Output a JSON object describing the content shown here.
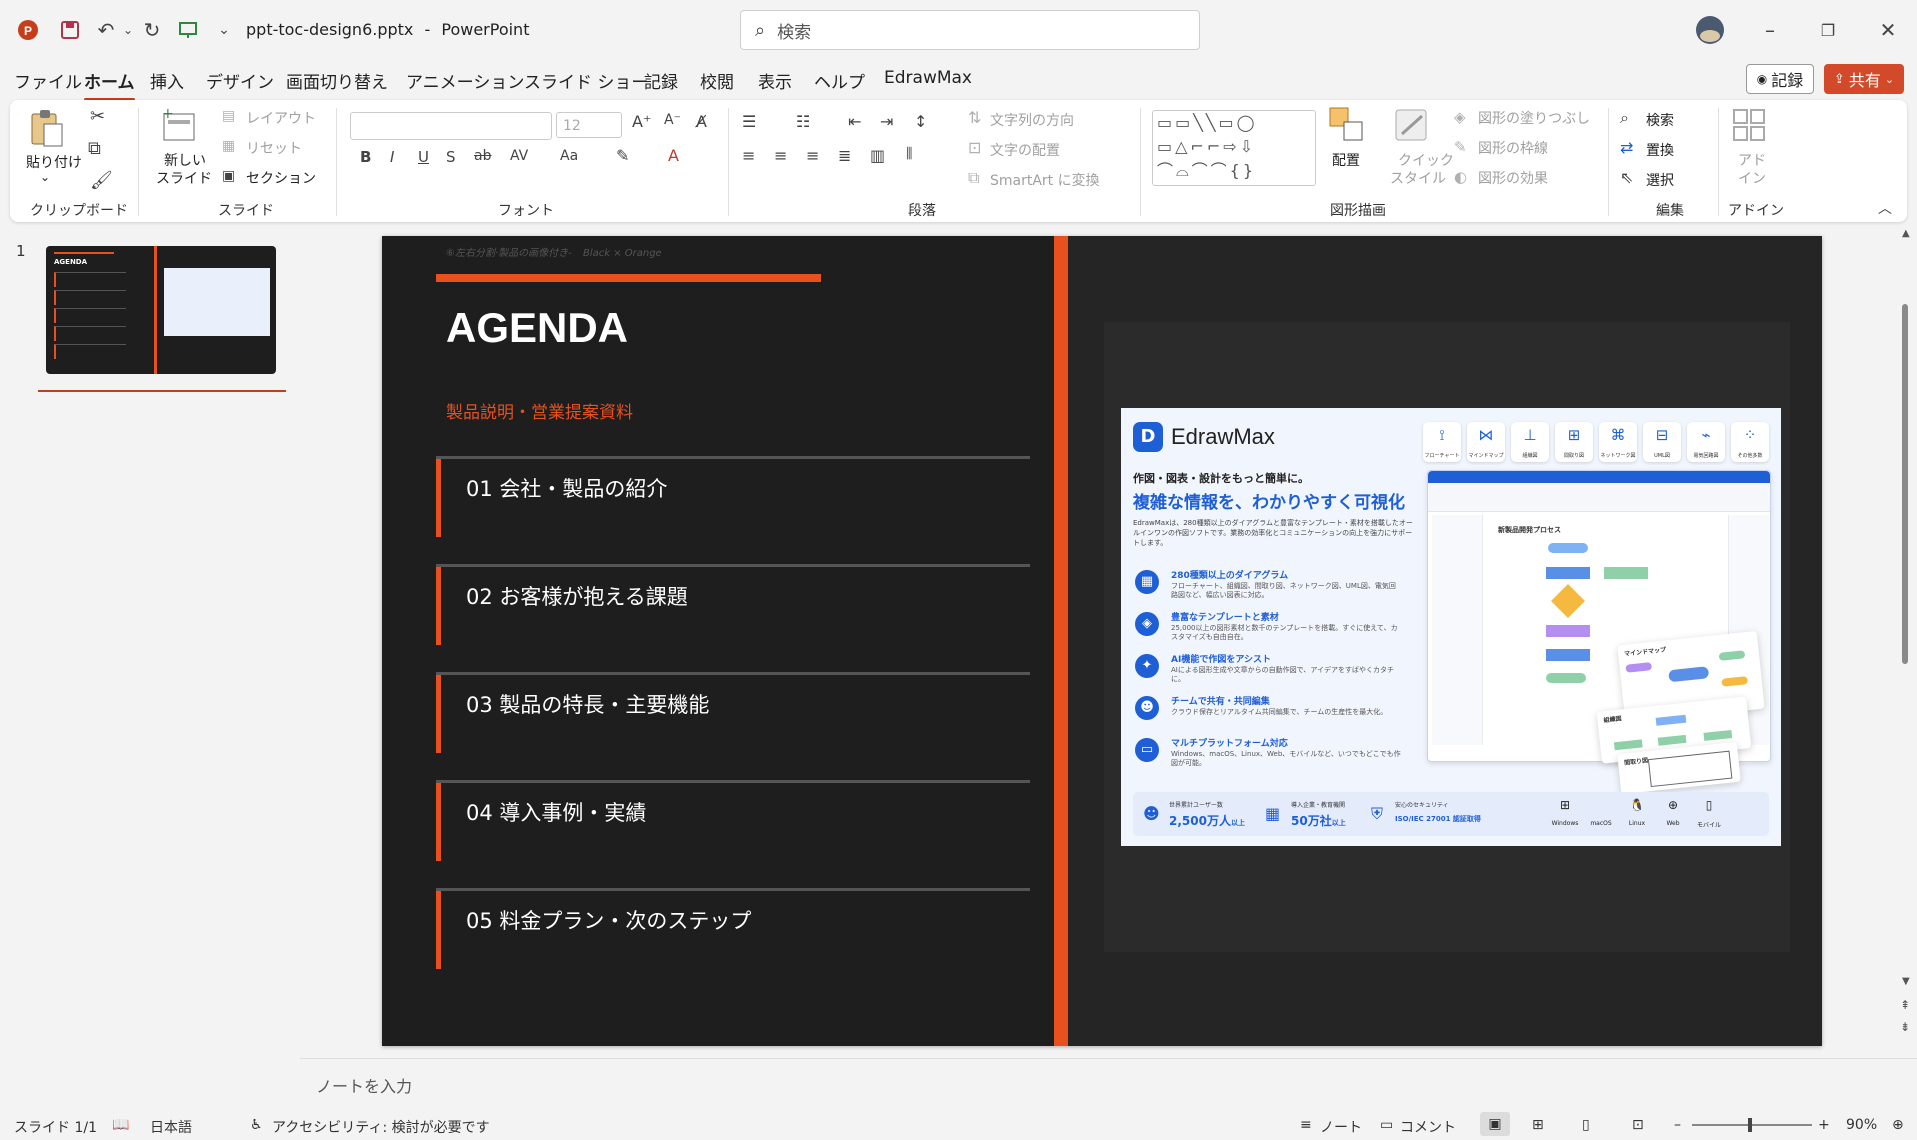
{
  "titlebar": {
    "filename": "ppt-toc-design6.pptx",
    "separator": "-",
    "app_name": "PowerPoint",
    "search_placeholder": "検索"
  },
  "menu": {
    "tabs": [
      "ファイル",
      "ホーム",
      "挿入",
      "デザイン",
      "画面切り替え",
      "アニメーション",
      "スライド ショー",
      "記録",
      "校閲",
      "表示",
      "ヘルプ",
      "EdrawMax"
    ],
    "active_index": 1,
    "record_button": "記録",
    "share_button": "共有"
  },
  "ribbon": {
    "clipboard": {
      "paste": "貼り付け",
      "label": "クリップボード"
    },
    "slides": {
      "new_slide_1": "新しい",
      "new_slide_2": "スライド",
      "layout": "レイアウト",
      "reset": "リセット",
      "section": "セクション",
      "label": "スライド"
    },
    "font": {
      "size": "12",
      "label": "フォント"
    },
    "paragraph": {
      "text_direction": "文字列の方向",
      "align_text": "文字の配置",
      "smartart": "SmartArt に変換",
      "label": "段落"
    },
    "drawing": {
      "arrange": "配置",
      "quick_style_1": "クイック",
      "quick_style_2": "スタイル",
      "fill": "図形の塗りつぶし",
      "outline": "図形の枠線",
      "effects": "図形の効果",
      "label": "図形描画"
    },
    "editing": {
      "find": "検索",
      "replace": "置換",
      "select": "選択",
      "label": "編集"
    },
    "addins": {
      "addin_1": "アド",
      "addin_2": "イン",
      "label": "アドイン"
    }
  },
  "thumbnails": [
    {
      "number": "1"
    }
  ],
  "slide": {
    "top_caption": "⑥左右分割·製品の画像付き-",
    "top_caption_theme": "Black × Orange",
    "title": "AGENDA",
    "subtitle": "製品説明・営業提案資料",
    "accent_color": "#e8501e",
    "background": "#1e1e1e",
    "items": [
      "01  会社・製品の紹介",
      "02  お客様が抱える課題",
      "03  製品の特長・主要機能",
      "04  導入事例・実績",
      "05  料金プラン・次のステップ"
    ]
  },
  "product_image": {
    "brand": "EdrawMax",
    "tagline": "作図・図表・設計をもっと簡単に。",
    "headline": "複雑な情報を、わかりやすく可視化",
    "intro": "EdrawMaxは、280種類以上のダイアグラムと豊富なテンプレート・素材を搭載したオールインワンの作図ソフトです。業務の効率化とコミュニケーションの向上を強力にサポートします。",
    "tools": [
      "フローチャート",
      "マインドマップ",
      "組織図",
      "間取り図",
      "ネットワーク図",
      "UML図",
      "電気回路図",
      "その他多数"
    ],
    "features": [
      {
        "title": "280種類以上のダイアグラム",
        "desc": "フローチャート、組織図、間取り図、ネットワーク図、UML図、電気回路図など、幅広い図表に対応。"
      },
      {
        "title": "豊富なテンプレートと素材",
        "desc": "25,000以上の図形素材と数千のテンプレートを搭載。すぐに使えて、カスタマイズも自由自在。"
      },
      {
        "title": "AI機能で作図をアシスト",
        "desc": "AIによる図形生成や文章からの自動作図で、アイデアをすばやくカタチに。"
      },
      {
        "title": "チームで共有・共同編集",
        "desc": "クラウド保存とリアルタイム共同編集で、チームの生産性を最大化。"
      },
      {
        "title": "マルチプラットフォーム対応",
        "desc": "Windows、macOS、Linux、Web、モバイルなど、いつでもどこでも作図が可能。"
      }
    ],
    "stats": [
      {
        "label": "世界累計ユーザー数",
        "value": "2,500万人",
        "suffix": "以上"
      },
      {
        "label": "導入企業・教育機関",
        "value": "50万社",
        "suffix": "以上"
      },
      {
        "label": "安心のセキュリティ",
        "value": "ISO/IEC 27001 認証取得",
        "suffix": ""
      }
    ],
    "platforms": [
      "Windows",
      "macOS",
      "Linux",
      "Web",
      "モバイル"
    ],
    "flow_title": "新製品開発プロセス",
    "mindmap_title": "マインドマップ",
    "orgchart_title": "組織図",
    "floorplan_title": "間取り図"
  },
  "notes": {
    "placeholder": "ノートを入力"
  },
  "status": {
    "slide_counter": "スライド 1/1",
    "language": "日本語",
    "accessibility": "アクセシビリティ: 検討が必要です",
    "notes_button": "ノート",
    "comments_button": "コメント",
    "zoom": "90%"
  },
  "icons": {
    "app": "powerpoint-icon",
    "save": "save-icon",
    "undo": "undo-icon",
    "redo": "redo-icon",
    "minimize": "minimize-icon",
    "maximize": "maximize-icon",
    "close": "close-icon"
  },
  "colors": {
    "ppt_red": "#c43e1c",
    "share_button": "#d34a2a",
    "edraw_blue": "#1f5fd6"
  }
}
